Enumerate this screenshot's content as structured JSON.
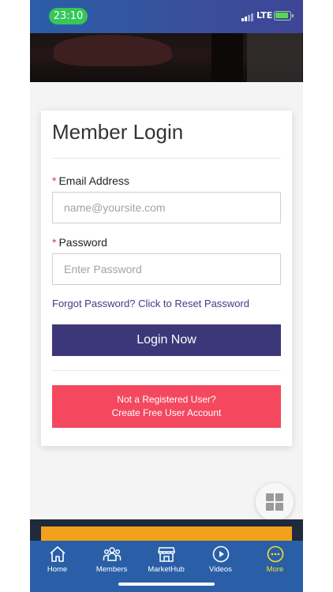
{
  "status_bar": {
    "time": "23:10",
    "network": "LTE"
  },
  "login": {
    "title": "Member Login",
    "email_label": "Email Address",
    "email_placeholder": "name@yoursite.com",
    "password_label": "Password",
    "password_placeholder": "Enter Password",
    "required_marker": "*",
    "forgot_link": "Forgot Password? Click to Reset Password",
    "login_button": "Login Now",
    "register_line1": "Not a Registered User?",
    "register_line2": "Create Free User Account"
  },
  "bottom_nav": {
    "items": [
      {
        "label": "Home",
        "icon": "home-icon"
      },
      {
        "label": "Members",
        "icon": "members-icon"
      },
      {
        "label": "MarketHub",
        "icon": "store-icon"
      },
      {
        "label": "Videos",
        "icon": "play-icon"
      },
      {
        "label": "More",
        "icon": "more-icon",
        "active": true
      }
    ]
  },
  "colors": {
    "primary_button": "#3b3779",
    "register_button": "#f4485f",
    "nav_background": "#2a5fa8",
    "active_nav": "#f1e22b",
    "time_pill": "#35c759"
  }
}
